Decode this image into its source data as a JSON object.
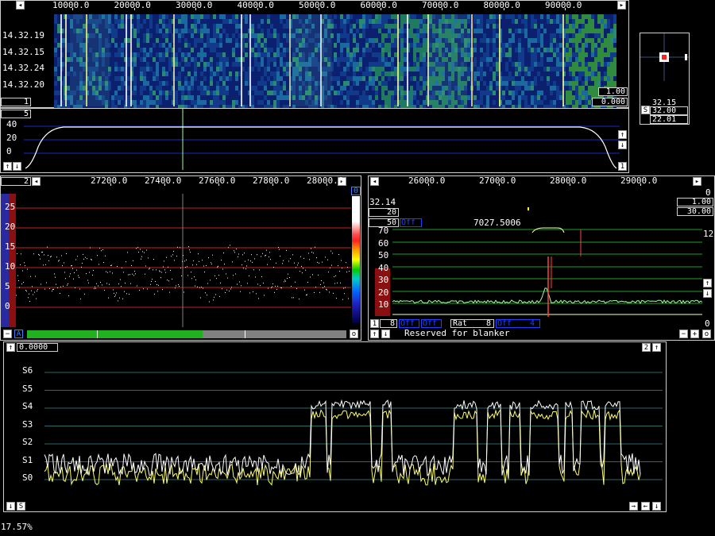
{
  "waterfall": {
    "freq_ticks": [
      "10000.0",
      "20000.0",
      "30000.0",
      "40000.0",
      "50000.0",
      "60000.0",
      "70000.0",
      "80000.0",
      "90000.0"
    ],
    "time_labels": [
      "14.32.19",
      "14.32.15",
      "14.32.24",
      "14.32.20"
    ],
    "zoom_box": "1",
    "gain_box": "1.00",
    "offset_box": "0.000"
  },
  "spectrum": {
    "avg_box": "5",
    "y_ticks": [
      "40",
      "20",
      "0"
    ],
    "corner_box": "1"
  },
  "pointer": {
    "values": [
      "32.15",
      "32.00",
      "22.01"
    ],
    "s_label": "S"
  },
  "baseband": {
    "box": "2",
    "freq_ticks": [
      "27200.0",
      "27400.0",
      "27600.0",
      "27800.0",
      "28000.0"
    ],
    "y_ticks": [
      "25",
      "20",
      "15",
      "10",
      "5",
      "0"
    ],
    "scale_top": "0",
    "a_label": "A",
    "o_label": "o"
  },
  "hires": {
    "freq_ticks": [
      "26000.0",
      "27000.0",
      "28000.0",
      "29000.0"
    ],
    "left_value": "32.14",
    "box_20": "20",
    "box_50": "50",
    "right_top": "0",
    "right_100": "1.00",
    "right_3000": "30.00",
    "off_label": "Off",
    "freq_readout": "7027.5006",
    "y_ticks": [
      "70",
      "60",
      "50",
      "40",
      "30",
      "20",
      "10"
    ],
    "right_12": "12",
    "right_0": "0",
    "box_1": "1",
    "box_8": "8",
    "off1": "Off",
    "off2": "Off",
    "rat_label": "Rat",
    "rat_value": "8",
    "off3": "Off",
    "off3_value": "4",
    "blanker_text": "Reserved for blanker"
  },
  "smeter": {
    "value_box": "0.0000",
    "box_2": "2",
    "s_ticks": [
      "S6",
      "S5",
      "S4",
      "S3",
      "S2",
      "S1",
      "S0"
    ],
    "s_button": "S"
  },
  "status": {
    "cpu": "17.57%"
  },
  "colors": {
    "blue_line": "#1a2cc8",
    "red_line": "#c82020",
    "green_line": "#20a020",
    "yellow_trace": "#ffff66",
    "white_trace": "#ffffff"
  }
}
